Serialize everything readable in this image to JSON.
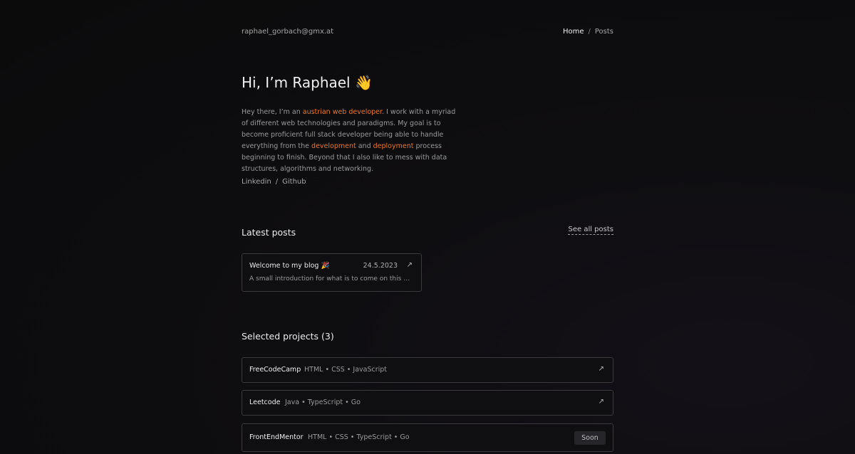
{
  "header": {
    "email": "raphael_gorbach@gmx.at",
    "nav": [
      {
        "label": "Home",
        "active": true
      },
      {
        "label": "Posts",
        "active": false
      }
    ],
    "nav_separator": "/"
  },
  "hero": {
    "title": "Hi, I’m Raphael 👋",
    "bio": {
      "p1": "Hey there, I’m an ",
      "hl1": "austrian web developer",
      "p2": ". I work with a myriad of different web technologies and paradigms. My goal is to become proficient full stack developer being able to handle everything from the ",
      "hl2": "development",
      "p3": " and ",
      "hl3": "deployment",
      "p4": " process beginning to finish. Beyond that I also like to mess with data structures, algorithms and networking."
    },
    "social": [
      {
        "label": "Linkedin"
      },
      {
        "label": "Github"
      }
    ],
    "social_separator": "/"
  },
  "latest_posts": {
    "title": "Latest posts",
    "see_all_label": "See all posts",
    "posts": [
      {
        "title": "Welcome to my blog 🎉",
        "date": "24.5.2023",
        "description": "A small introduction for what is to come on this blog",
        "arrow_icon": "↗"
      }
    ]
  },
  "projects": {
    "title": "Selected projects (3)",
    "items": [
      {
        "name": "FreeCodeCamp",
        "tags": "HTML • CSS • JavaScript",
        "arrow_icon": "↗"
      },
      {
        "name": "Leetcode",
        "tags": "Java • TypeScript • Go",
        "arrow_icon": "↗"
      },
      {
        "name": "FrontEndMentor",
        "tags": "HTML • CSS • TypeScript • Go",
        "badge": "Soon"
      }
    ]
  },
  "colors": {
    "accent": "#e8782a",
    "background": "#0b0b0c",
    "card_border": "#3a3a3d"
  }
}
